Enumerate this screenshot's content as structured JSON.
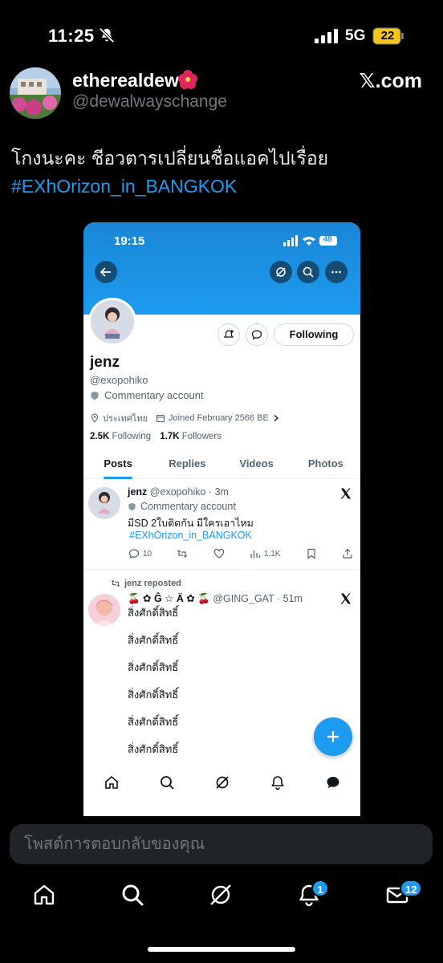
{
  "status_bar": {
    "time": "11:25",
    "network": "5G",
    "battery": "22",
    "icons": [
      "bell-slash-icon",
      "signal-icon",
      "battery-icon"
    ]
  },
  "tweet": {
    "display_name": "etherealdew",
    "handle": "@dewalwayschange",
    "source": "𝕏.com",
    "text": "โกงนะคะ ชีอวตารเปลี่ยนชื่อแอคไปเรื่อย",
    "hashtag": "#EXhOrizon_in_BANGKOK",
    "name_emoji": "hibiscus-icon"
  },
  "embed": {
    "time": "19:15",
    "battery": "48",
    "profile": {
      "name": "jenz",
      "handle": "@exopohiko",
      "label": "Commentary account",
      "location": "ประเทศไทย",
      "joined": "Joined February 2566 BE",
      "following_count": "2.5K",
      "following_label": "Following",
      "followers_count": "1.7K",
      "followers_label": "Followers",
      "follow_button": "Following"
    },
    "tabs": [
      "Posts",
      "Replies",
      "Videos",
      "Photos"
    ],
    "post1": {
      "name": "jenz",
      "handle_time": "@exopohiko · 3m",
      "label": "Commentary account",
      "text": "มีSD 2ใบติดกัน มีใครเอาไหม",
      "hashtag": "#EXhOrizon_in_BANGKOK",
      "replies": "10",
      "views": "1.1K"
    },
    "post2": {
      "repost_label": "jenz reposted",
      "name": "🍒 ✿ Ĝ ☆ Ä ✿ 🍒",
      "handle_time": "@GING_GAT · 51m",
      "lines": [
        "สิ่งศักดิ์สิทธิ์",
        "สิ่งศักดิ์สิทธิ์",
        "สิ่งศักดิ์สิทธิ์",
        "สิ่งศักดิ์สิทธิ์",
        "สิ่งศักดิ์สิทธิ์",
        "สิ่งศักดิ์สิทธิ์"
      ]
    }
  },
  "reply": {
    "placeholder": "โพสต์การตอบกลับของคุณ"
  },
  "bottom_nav": {
    "notifications_badge": "1",
    "messages_badge": "12"
  },
  "colors": {
    "accent": "#1d9bf0",
    "background": "#000000",
    "reply_box": "#202327"
  }
}
